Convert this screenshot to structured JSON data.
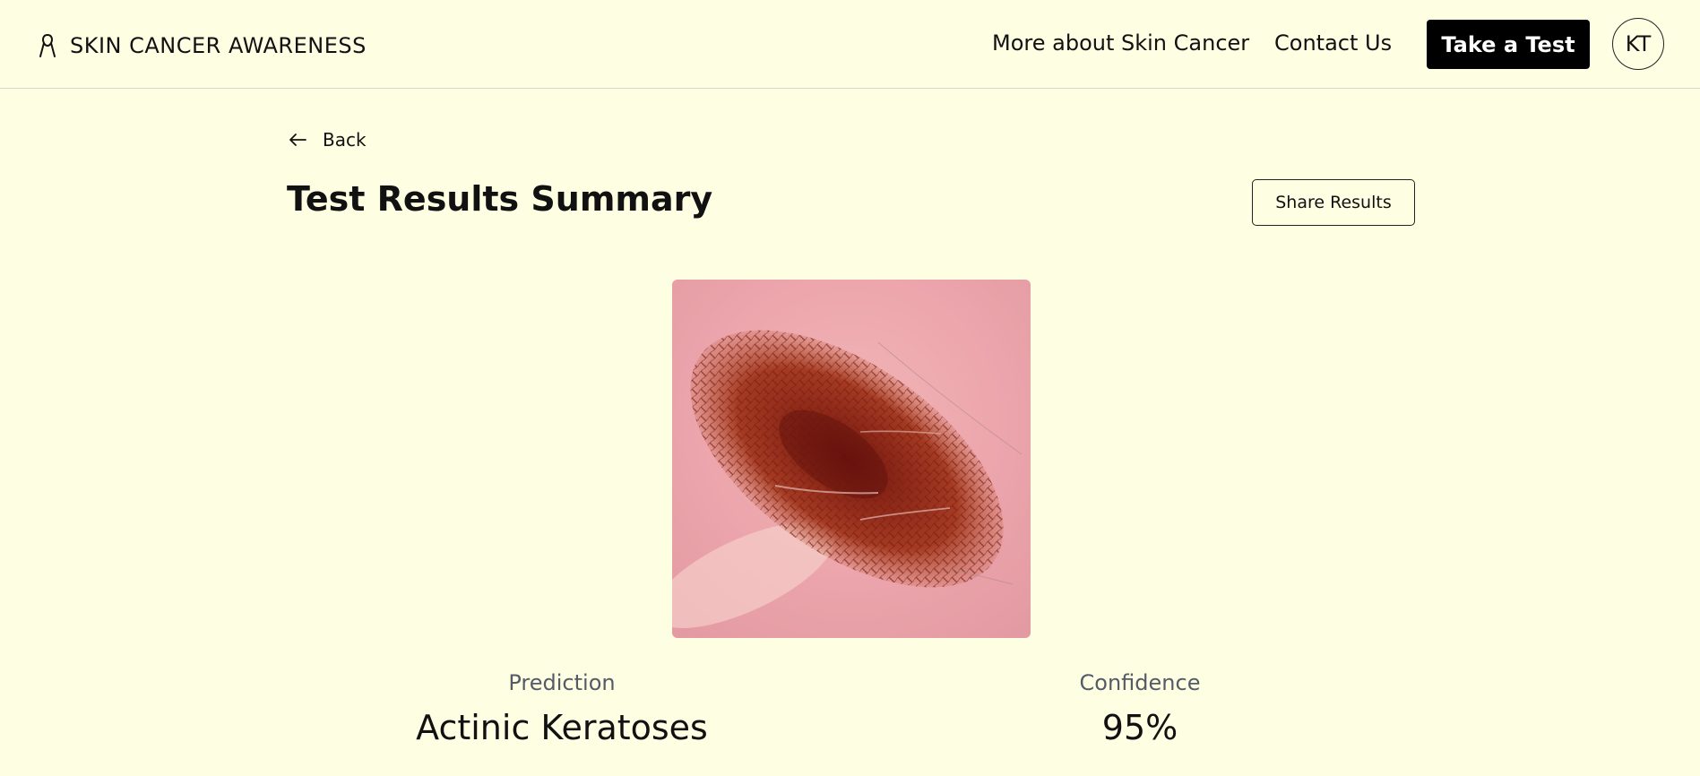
{
  "header": {
    "brand": "SKIN CANCER AWARENESS",
    "brand_icon": "ribbon-icon",
    "nav": {
      "more_about": "More about Skin Cancer",
      "contact": "Contact Us"
    },
    "cta": "Take a Test",
    "avatar_initials": "KT"
  },
  "page": {
    "back_label": "Back",
    "back_icon": "arrow-left-icon",
    "title": "Test Results Summary",
    "share_label": "Share Results"
  },
  "results": {
    "prediction_label": "Prediction",
    "prediction_value": "Actinic Keratoses",
    "confidence_label": "Confidence",
    "confidence_value": "95%"
  },
  "colors": {
    "background": "#FEFEE2",
    "cta_background": "#000000",
    "text": "#111111",
    "muted_text": "#555B66"
  }
}
